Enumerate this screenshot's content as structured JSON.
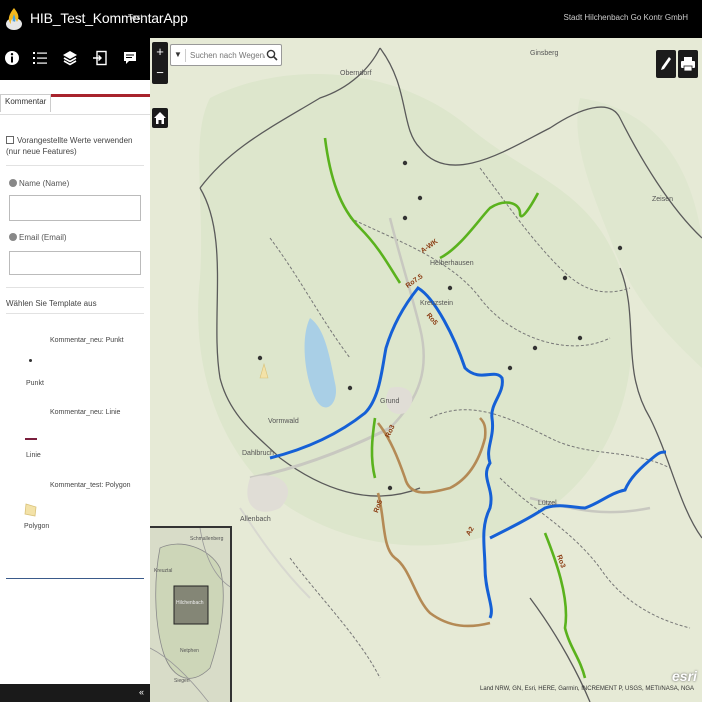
{
  "header": {
    "title": "HIB_Test_KommentarApp",
    "subtitle": "Test",
    "links": "Stadt Hilchenbach  Go Kontr GmbH"
  },
  "panel": {
    "tab_label": "Kommentar",
    "checkbox_label": "Vorangestellte Werte verwenden (nur neue Features)",
    "name_label": "Name (Name)",
    "email_label": "Email (Email)",
    "templates_title": "Wählen Sie Template aus",
    "templates": [
      {
        "heading": "Kommentar_neu: Punkt",
        "caption": "Punkt"
      },
      {
        "heading": "Kommentar_neu: Linie",
        "caption": "Linie"
      },
      {
        "heading": "Kommentar_test: Polygon",
        "caption": "Polygon"
      }
    ],
    "collapse_glyph": "«"
  },
  "map": {
    "search_placeholder": "Suchen nach Wegen/Wanderr",
    "attribution": "Land NRW, GN, Esri, HERE, Garmin, INCREMENT P, USGS, METI/NASA, NGA",
    "esri_logo": "esri",
    "labels": {
      "town_left": "Dahlbruch",
      "place1": "Allenbach",
      "place2": "Helberhausen",
      "place3": "Lützel",
      "place4": "Zeisen",
      "place5": "Grund",
      "place6": "Vormwald",
      "place7": "Oberndorf",
      "place8": "Kreuzstein",
      "place9": "Ginsberg"
    },
    "route_labels": [
      "A-WK",
      "Ro7.5",
      "Ro5",
      "Ro3",
      "A2",
      "Ro5",
      "Ro3"
    ],
    "overview_labels": [
      "Hilchenbach",
      "Schmallenberg",
      "Netphen",
      "Siegen",
      "Kreuztal"
    ]
  },
  "colors": {
    "route_blue": "#1560d6",
    "route_green": "#5ab21d",
    "route_brown": "#b48a55",
    "accent_red": "#a8232d"
  },
  "icons": {
    "logo": "flame-logo-icon",
    "toolbar": [
      "info-icon",
      "legend-icon",
      "layers-icon",
      "export-icon",
      "comment-icon"
    ],
    "map": [
      "zoom-in-icon",
      "zoom-out-icon",
      "home-icon",
      "search-icon",
      "edit-icon",
      "print-icon"
    ]
  }
}
